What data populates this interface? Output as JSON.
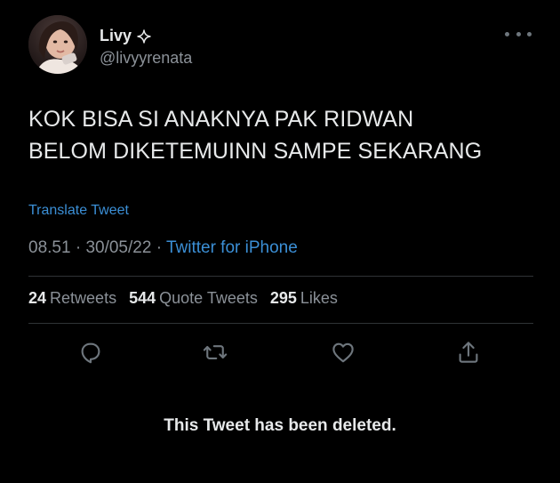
{
  "profile": {
    "display_name": "Livy",
    "handle": "@livyyrenata"
  },
  "tweet": {
    "text_line1": "KOK BISA SI ANAKNYA PAK RIDWAN",
    "text_line2": "BELOM DIKETEMUINN SAMPE SEKARANG",
    "translate_label": "Translate Tweet",
    "time": "08.51",
    "date": "30/05/22",
    "separator": "·",
    "source": "Twitter for iPhone"
  },
  "stats": {
    "retweets_count": "24",
    "retweets_label": "Retweets",
    "quotes_count": "544",
    "quotes_label": "Quote Tweets",
    "likes_count": "295",
    "likes_label": "Likes"
  },
  "actions": {
    "reply_icon": "reply-icon",
    "retweet_icon": "retweet-icon",
    "like_icon": "heart-icon",
    "share_icon": "share-icon"
  },
  "deleted_notice": "This Tweet has been deleted.",
  "colors": {
    "background": "#000000",
    "text_primary": "#e7e9ea",
    "text_secondary": "#8b9198",
    "link": "#3b8fd6",
    "divider": "#2f3336",
    "icon": "#6e767d"
  }
}
